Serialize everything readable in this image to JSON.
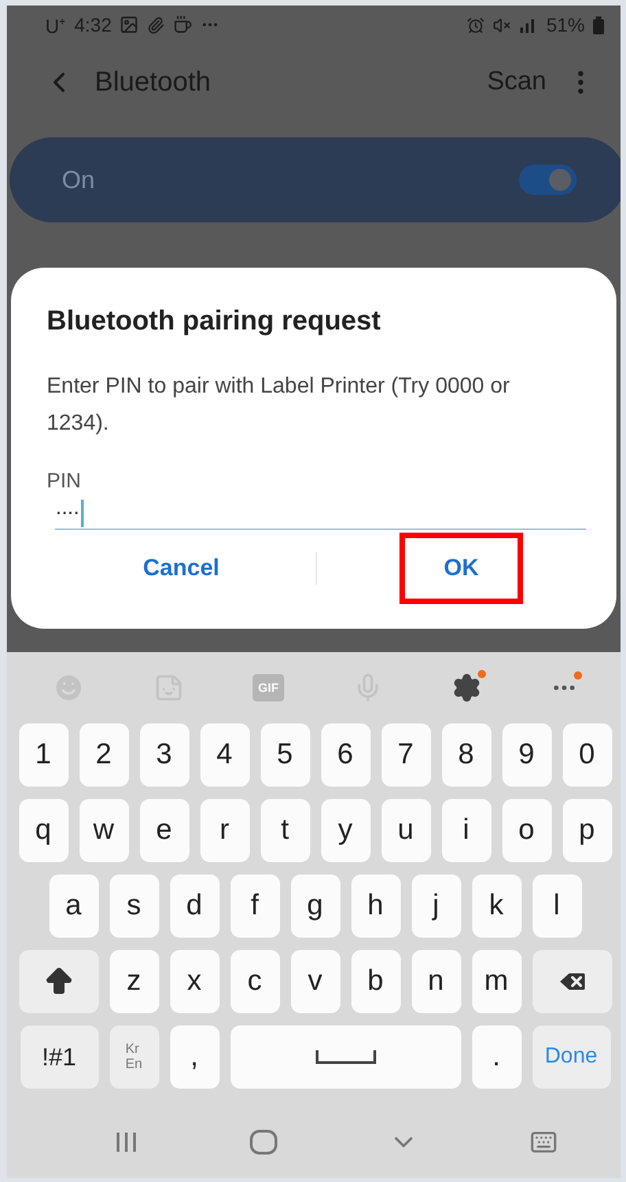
{
  "status_bar": {
    "carrier": "U⁺",
    "time": "4:32",
    "battery": "51%"
  },
  "header": {
    "title": "Bluetooth",
    "action": "Scan"
  },
  "bluetooth_switch": {
    "label": "On",
    "on": true
  },
  "dialog": {
    "title": "Bluetooth pairing request",
    "message": "Enter PIN to pair with Label Printer (Try 0000 or 1234).",
    "field": {
      "label": "PIN",
      "value": "····"
    },
    "buttons": [
      {
        "label": "Cancel",
        "highlighted": false
      },
      {
        "label": "OK",
        "highlighted": true
      }
    ]
  },
  "keyboard": {
    "toolbar": {
      "gif_label": "GIF"
    },
    "rows": [
      {
        "keys": [
          {
            "kind": "char",
            "label": "1"
          },
          {
            "kind": "char",
            "label": "2"
          },
          {
            "kind": "char",
            "label": "3"
          },
          {
            "kind": "char",
            "label": "4"
          },
          {
            "kind": "char",
            "label": "5"
          },
          {
            "kind": "char",
            "label": "6"
          },
          {
            "kind": "char",
            "label": "7"
          },
          {
            "kind": "char",
            "label": "8"
          },
          {
            "kind": "char",
            "label": "9"
          },
          {
            "kind": "char",
            "label": "0"
          }
        ]
      },
      {
        "keys": [
          {
            "kind": "char",
            "label": "q"
          },
          {
            "kind": "char",
            "label": "w"
          },
          {
            "kind": "char",
            "label": "e"
          },
          {
            "kind": "char",
            "label": "r"
          },
          {
            "kind": "char",
            "label": "t"
          },
          {
            "kind": "char",
            "label": "y"
          },
          {
            "kind": "char",
            "label": "u"
          },
          {
            "kind": "char",
            "label": "i"
          },
          {
            "kind": "char",
            "label": "o"
          },
          {
            "kind": "char",
            "label": "p"
          }
        ]
      },
      {
        "keys": [
          {
            "kind": "char",
            "label": "a"
          },
          {
            "kind": "char",
            "label": "s"
          },
          {
            "kind": "char",
            "label": "d"
          },
          {
            "kind": "char",
            "label": "f"
          },
          {
            "kind": "char",
            "label": "g"
          },
          {
            "kind": "char",
            "label": "h"
          },
          {
            "kind": "char",
            "label": "j"
          },
          {
            "kind": "char",
            "label": "k"
          },
          {
            "kind": "char",
            "label": "l"
          }
        ]
      },
      {
        "keys": [
          {
            "kind": "shift"
          },
          {
            "kind": "char",
            "label": "z"
          },
          {
            "kind": "char",
            "label": "x"
          },
          {
            "kind": "char",
            "label": "c"
          },
          {
            "kind": "char",
            "label": "v"
          },
          {
            "kind": "char",
            "label": "b"
          },
          {
            "kind": "char",
            "label": "n"
          },
          {
            "kind": "char",
            "label": "m"
          },
          {
            "kind": "backspace"
          }
        ]
      },
      {
        "keys": [
          {
            "kind": "symbols",
            "label": "!#1"
          },
          {
            "kind": "language",
            "top": "Kr",
            "bottom": "En"
          },
          {
            "kind": "char",
            "label": ","
          },
          {
            "kind": "space"
          },
          {
            "kind": "char",
            "label": "."
          },
          {
            "kind": "done",
            "label": "Done"
          }
        ]
      }
    ]
  }
}
